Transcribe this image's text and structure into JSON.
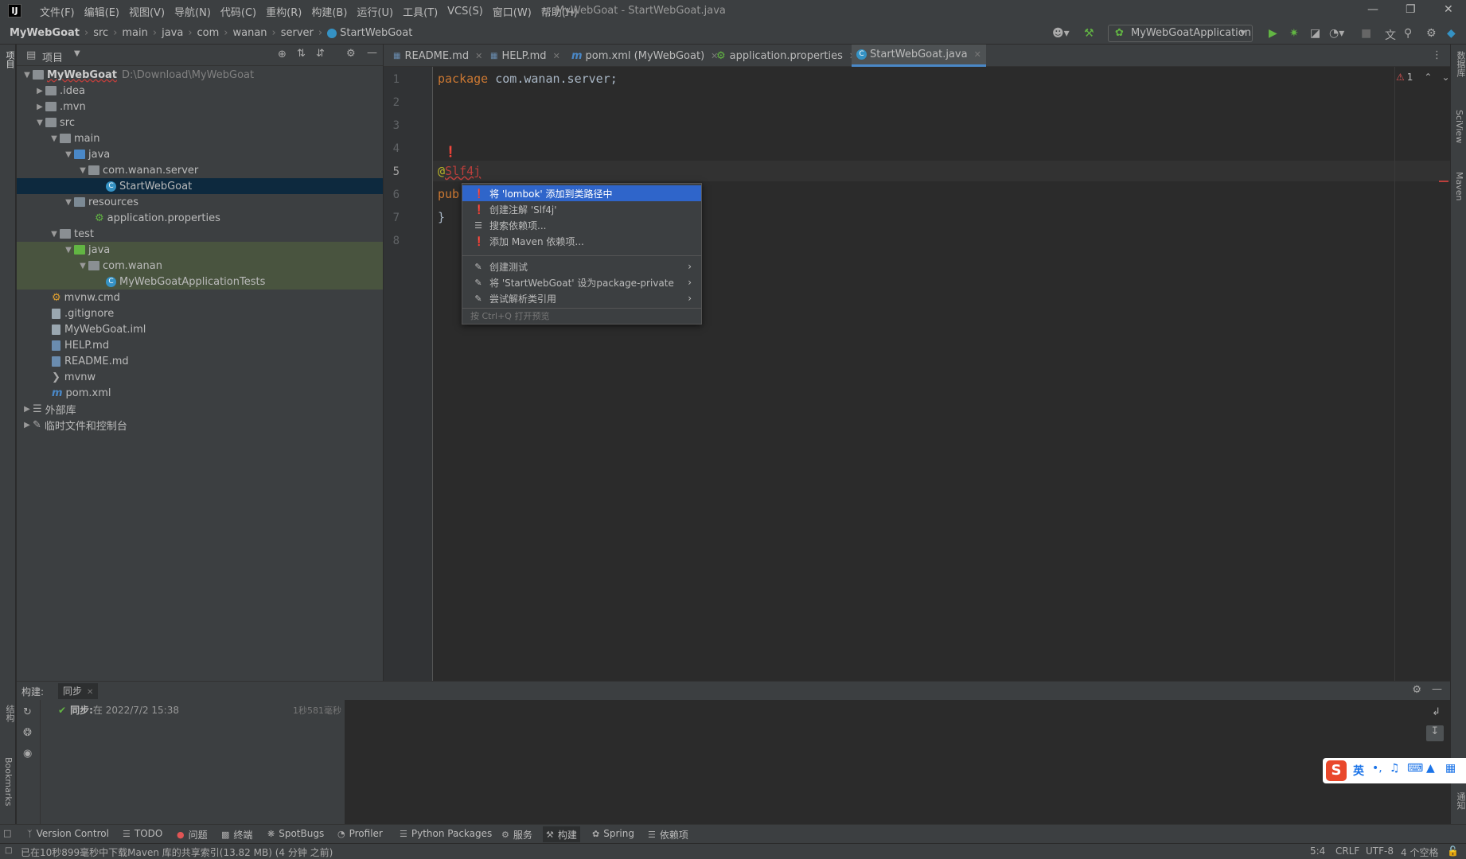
{
  "menubar": {
    "logo": "IJ",
    "menus": [
      "文件(F)",
      "编辑(E)",
      "视图(V)",
      "导航(N)",
      "代码(C)",
      "重构(R)",
      "构建(B)",
      "运行(U)",
      "工具(T)",
      "VCS(S)",
      "窗口(W)",
      "帮助(H)"
    ],
    "title": "MyWebGoat - StartWebGoat.java"
  },
  "breadcrumb": [
    "MyWebGoat",
    "src",
    "main",
    "java",
    "com",
    "wanan",
    "server",
    "StartWebGoat"
  ],
  "run_config": "MyWebGoatApplication",
  "left_strip": {
    "project": "项目",
    "structure": "结构",
    "bookmarks": "Bookmarks"
  },
  "right_strip": {
    "database": "数据库",
    "sciview": "SciView",
    "maven": "Maven",
    "notifications": "通知"
  },
  "project": {
    "header": "项目",
    "tree": [
      {
        "label": "MyWebGoat",
        "path": "D:\\Download\\MyWebGoat"
      },
      {
        "label": ".idea"
      },
      {
        "label": ".mvn"
      },
      {
        "label": "src"
      },
      {
        "label": "main"
      },
      {
        "label": "java"
      },
      {
        "label": "com.wanan.server"
      },
      {
        "label": "StartWebGoat"
      },
      {
        "label": "resources"
      },
      {
        "label": "application.properties"
      },
      {
        "label": "test"
      },
      {
        "label": "java"
      },
      {
        "label": "com.wanan"
      },
      {
        "label": "MyWebGoatApplicationTests"
      },
      {
        "label": "mvnw.cmd"
      },
      {
        "label": ".gitignore"
      },
      {
        "label": "MyWebGoat.iml"
      },
      {
        "label": "HELP.md"
      },
      {
        "label": "README.md"
      },
      {
        "label": "mvnw"
      },
      {
        "label": "pom.xml"
      },
      {
        "label": "外部库"
      },
      {
        "label": "临时文件和控制台"
      }
    ]
  },
  "tabs": [
    {
      "label": "README.md"
    },
    {
      "label": "HELP.md"
    },
    {
      "label": "pom.xml (MyWebGoat)"
    },
    {
      "label": "application.properties"
    },
    {
      "label": "StartWebGoat.java"
    }
  ],
  "editor": {
    "line_numbers": [
      "1",
      "2",
      "3",
      "4",
      "5",
      "6",
      "7",
      "8"
    ],
    "line1_kw": "package",
    "line1_rest": " com.wanan.server;",
    "line5_at": "@",
    "line5_ann": "Slf4j",
    "line6": "pub",
    "line7": "}",
    "error_count": "1"
  },
  "popup": {
    "items": [
      "将 'lombok' 添加到类路径中",
      "创建注解 'Slf4j'",
      "搜索依赖项...",
      "添加 Maven 依赖项...",
      "创建测试",
      "将 'StartWebGoat' 设为package-private",
      "尝试解析类引用"
    ],
    "footer": "按 Ctrl+Q 打开预览"
  },
  "build": {
    "label": "构建:",
    "tab": "同步",
    "sync_label": "同步:",
    "sync_text": " 在 2022/7/2 15:38",
    "duration": "1秒581毫秒"
  },
  "toolwindows": [
    "Version Control",
    "TODO",
    "问题",
    "终端",
    "SpotBugs",
    "Profiler",
    "Python Packages",
    "服务",
    "构建",
    "Spring",
    "依赖项"
  ],
  "status": {
    "message": "已在10秒899毫秒中下载Maven 库的共享索引(13.82 MB) (4 分钟 之前)",
    "position": "5:4",
    "line_sep": "CRLF",
    "encoding": "UTF-8",
    "indent": "4 个空格"
  },
  "ime": {
    "mode": "英"
  }
}
